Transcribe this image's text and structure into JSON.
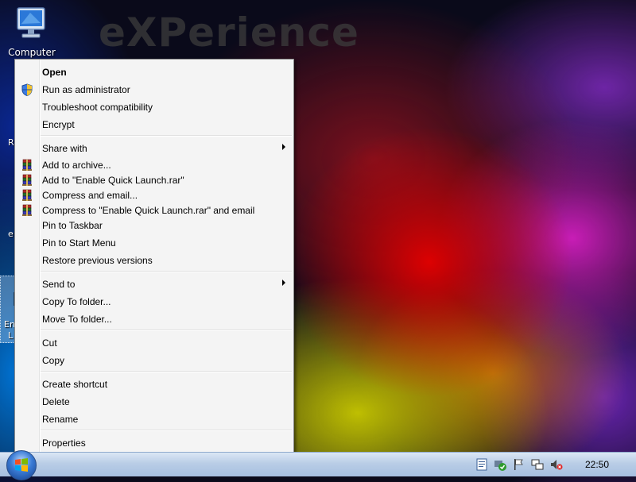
{
  "desktop": {
    "watermark": "eXPerience",
    "computer_label": "Computer",
    "partial_labels": [
      "R",
      "e",
      "En",
      "L"
    ]
  },
  "context_menu": {
    "items": [
      {
        "label": "Open",
        "bold": true,
        "icon": ""
      },
      {
        "label": "Run as administrator",
        "icon": "uac-shield-icon"
      },
      {
        "label": "Troubleshoot compatibility",
        "icon": ""
      },
      {
        "label": "Encrypt",
        "icon": ""
      },
      {
        "label": "Share with",
        "icon": "",
        "submenu": true
      },
      {
        "label": "Add to archive...",
        "icon": "winrar-icon"
      },
      {
        "label": "Add to \"Enable Quick Launch.rar\"",
        "icon": "winrar-icon"
      },
      {
        "label": "Compress and email...",
        "icon": "winrar-icon"
      },
      {
        "label": "Compress to \"Enable Quick Launch.rar\" and email",
        "icon": "winrar-icon"
      },
      {
        "label": "Pin to Taskbar",
        "icon": ""
      },
      {
        "label": "Pin to Start Menu",
        "icon": ""
      },
      {
        "label": "Restore previous versions",
        "icon": ""
      },
      {
        "label": "Send to",
        "icon": "",
        "submenu": true
      },
      {
        "label": "Copy To folder...",
        "icon": ""
      },
      {
        "label": "Move To folder...",
        "icon": ""
      },
      {
        "label": "Cut",
        "icon": ""
      },
      {
        "label": "Copy",
        "icon": ""
      },
      {
        "label": "Create shortcut",
        "icon": ""
      },
      {
        "label": "Delete",
        "icon": ""
      },
      {
        "label": "Rename",
        "icon": ""
      },
      {
        "label": "Properties",
        "icon": ""
      }
    ]
  },
  "taskbar": {
    "start_icon": "windows-start-orb-icon",
    "tray_icons": [
      "notepad-icon",
      "security-center-icon",
      "action-center-flag-icon",
      "network-icon",
      "volume-muted-icon"
    ],
    "clock": "22:50"
  }
}
